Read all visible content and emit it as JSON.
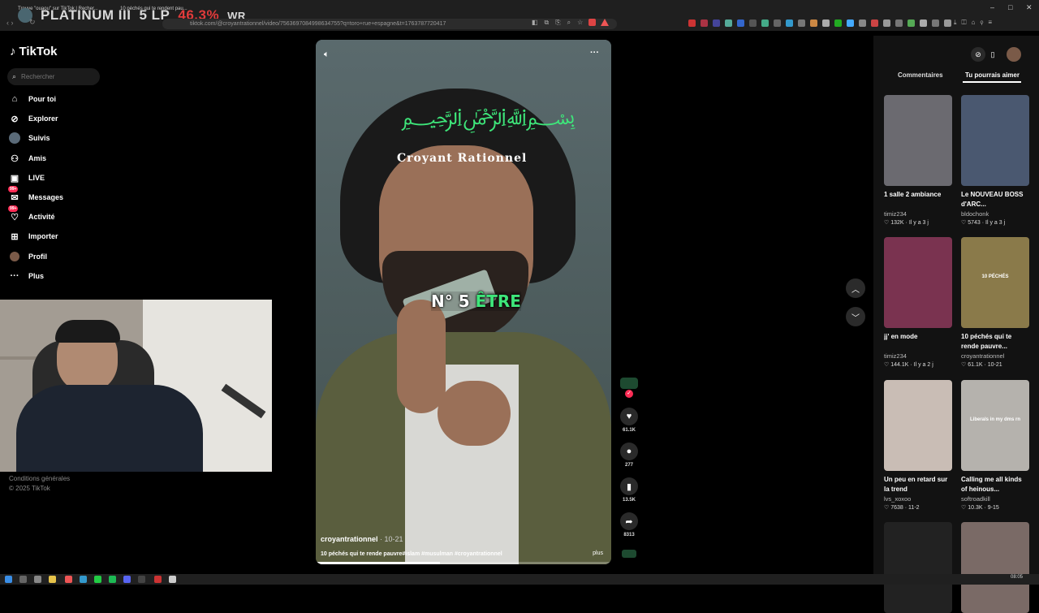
{
  "browser": {
    "tab_title": "Trouve \"ouaou\" sur TikTok | Recher...",
    "tab2_title": "10 péchés qui te rendent pau...",
    "url": "tiktok.com/@croyantrationnel/video/7563697084998634755?q=toro+rue+espagne&t=1763787720417"
  },
  "overlay": {
    "rank": "PLATINUM III",
    "lp": "5 LP",
    "winrate": "46.3%",
    "wr_label": "WR"
  },
  "sidebar": {
    "logo": "TikTok",
    "search_placeholder": "Rechercher",
    "items": [
      {
        "label": "Pour toi",
        "icon": "home-icon",
        "badge": ""
      },
      {
        "label": "Explorer",
        "icon": "compass-icon",
        "badge": ""
      },
      {
        "label": "Suivis",
        "icon": "following-avatar-icon",
        "badge": ""
      },
      {
        "label": "Amis",
        "icon": "friends-icon",
        "badge": ""
      },
      {
        "label": "LIVE",
        "icon": "live-icon",
        "badge": ""
      },
      {
        "label": "Messages",
        "icon": "message-icon",
        "badge": "99+"
      },
      {
        "label": "Activité",
        "icon": "activity-icon",
        "badge": "99+"
      },
      {
        "label": "Importer",
        "icon": "upload-icon",
        "badge": ""
      },
      {
        "label": "Profil",
        "icon": "profile-avatar-icon",
        "badge": ""
      },
      {
        "label": "Plus",
        "icon": "more-icon",
        "badge": ""
      }
    ],
    "footer_terms": "Conditions générales",
    "footer_copyright": "© 2025 TikTok"
  },
  "video": {
    "sticker_text": "Croyant Rationnel",
    "caption_prefix": "N° 5 ",
    "caption_highlight": "ÊTRE",
    "author": "croyantrationnel",
    "date": " · 10-21",
    "description": "10 péchés qui te rende pauvre#islam #musulman #croyantrationnel",
    "more": "plus",
    "progress": 0.42
  },
  "actions": {
    "likes": "61.1K",
    "comments": "277",
    "saves": "13.5K",
    "shares": "8313"
  },
  "right_panel": {
    "tab_comments": "Commentaires",
    "tab_suggestions": "Tu pourrais aimer",
    "cards": [
      {
        "title": "1 salle 2 ambiance",
        "author": "timiz234",
        "likes": "132K",
        "time": "Il y a 3 j",
        "bg": "#6b6a70"
      },
      {
        "title": "Le NOUVEAU BOSS d'ARC...",
        "author": "bldochonk",
        "likes": "5743",
        "time": "Il y a 3 j",
        "bg": "#4a5870"
      },
      {
        "title": "jj' en mode",
        "author": "timiz234",
        "likes": "144.1K",
        "time": "Il y a 2 j",
        "bg": "#7a3350"
      },
      {
        "title": "10 péchés qui te rende pauvre...",
        "author": "croyantrationnel",
        "likes": "61.1K",
        "time": "10-21",
        "bg": "#8a7a4a",
        "thumb_text": "10 PÉCHÉS"
      },
      {
        "title": "Un peu en retard sur la trend",
        "author": "lvs_xoxoo",
        "likes": "7638",
        "time": "11-2",
        "bg": "#c9bdb5"
      },
      {
        "title": "Calling me all kinds of heinous...",
        "author": "softroadkill",
        "likes": "10.3K",
        "time": "9-15",
        "bg": "#b5b2ad",
        "thumb_text": "Liberals in my dms rn"
      },
      {
        "title": "",
        "author": "",
        "likes": "",
        "time": "",
        "bg": "#222"
      },
      {
        "title": "",
        "author": "",
        "likes": "",
        "time": "",
        "bg": "#7a6a66"
      }
    ]
  },
  "taskbar": {
    "time": "08:05"
  }
}
